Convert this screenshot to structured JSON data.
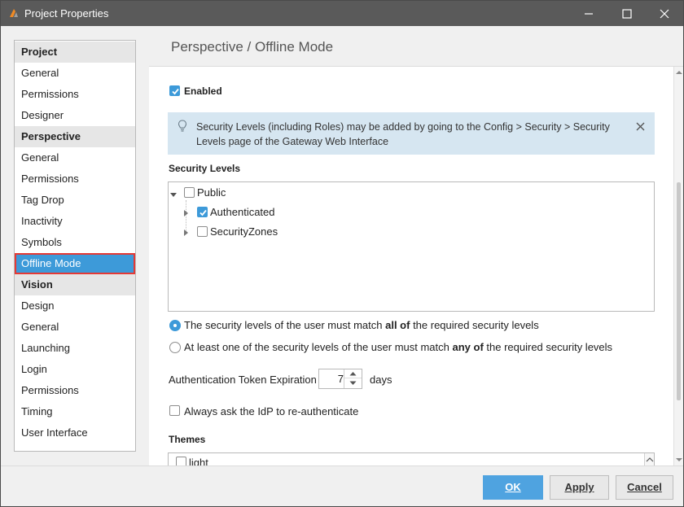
{
  "window": {
    "title": "Project Properties"
  },
  "sidebar": {
    "items": [
      {
        "label": "Project",
        "type": "header"
      },
      {
        "label": "General",
        "type": "item"
      },
      {
        "label": "Permissions",
        "type": "item"
      },
      {
        "label": "Designer",
        "type": "item"
      },
      {
        "label": "Perspective",
        "type": "header"
      },
      {
        "label": "General",
        "type": "item"
      },
      {
        "label": "Permissions",
        "type": "item"
      },
      {
        "label": "Tag Drop",
        "type": "item"
      },
      {
        "label": "Inactivity",
        "type": "item"
      },
      {
        "label": "Symbols",
        "type": "item"
      },
      {
        "label": "Offline Mode",
        "type": "selected"
      },
      {
        "label": "Vision",
        "type": "header"
      },
      {
        "label": "Design",
        "type": "item"
      },
      {
        "label": "General",
        "type": "item"
      },
      {
        "label": "Launching",
        "type": "item"
      },
      {
        "label": "Login",
        "type": "item"
      },
      {
        "label": "Permissions",
        "type": "item"
      },
      {
        "label": "Timing",
        "type": "item"
      },
      {
        "label": "User Interface",
        "type": "item"
      }
    ]
  },
  "main": {
    "title": "Perspective / Offline Mode",
    "enabled": {
      "label": "Enabled",
      "checked": true
    },
    "info": {
      "text": "Security Levels (including Roles) may be added by going to the Config > Security > Security Levels page of the Gateway Web Interface"
    },
    "security_levels": {
      "label": "Security Levels",
      "tree": [
        {
          "label": "Public",
          "checked": false,
          "expanded": true
        },
        {
          "label": "Authenticated",
          "checked": true
        },
        {
          "label": "SecurityZones",
          "checked": false
        }
      ]
    },
    "match_options": {
      "all": {
        "prefix": "The security levels of the user must match ",
        "emphasis": "all of",
        "suffix": " the required security levels",
        "selected": true
      },
      "any": {
        "prefix": "At least one of the security levels of the user must match ",
        "emphasis": "any of",
        "suffix": " the required security levels",
        "selected": false
      }
    },
    "token_expiration": {
      "label": "Authentication Token Expiration",
      "value": "7",
      "unit": "days"
    },
    "reauth": {
      "label": "Always ask the IdP to re-authenticate",
      "checked": false
    },
    "themes": {
      "label": "Themes",
      "first_item": "light"
    }
  },
  "footer": {
    "ok": "OK",
    "apply": "Apply",
    "cancel": "Cancel"
  },
  "colors": {
    "accent": "#3d9ad9",
    "selection_outline": "#e53935",
    "info_bg": "#d6e6f1",
    "titlebar": "#5a5a5a"
  }
}
